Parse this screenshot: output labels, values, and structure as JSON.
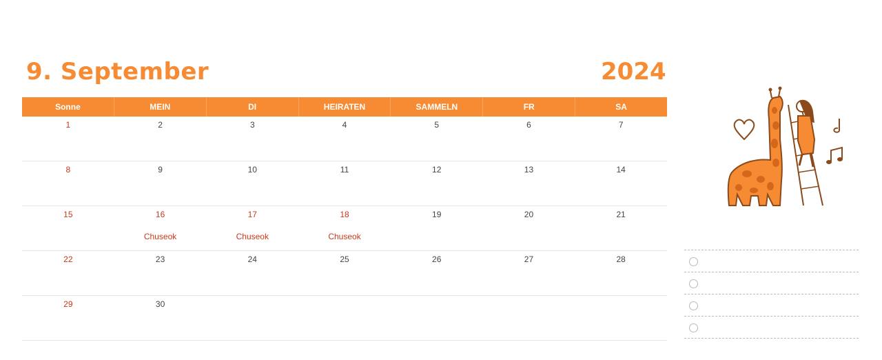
{
  "header": {
    "month": "9. September",
    "year": "2024"
  },
  "weekdays": [
    "Sonne",
    "MEIN",
    "DI",
    "HEIRATEN",
    "SAMMELN",
    "FR",
    "SA"
  ],
  "weeks": [
    [
      {
        "day": "1",
        "red": true,
        "event": ""
      },
      {
        "day": "2",
        "red": false,
        "event": ""
      },
      {
        "day": "3",
        "red": false,
        "event": ""
      },
      {
        "day": "4",
        "red": false,
        "event": ""
      },
      {
        "day": "5",
        "red": false,
        "event": ""
      },
      {
        "day": "6",
        "red": false,
        "event": ""
      },
      {
        "day": "7",
        "red": false,
        "event": ""
      }
    ],
    [
      {
        "day": "8",
        "red": true,
        "event": ""
      },
      {
        "day": "9",
        "red": false,
        "event": ""
      },
      {
        "day": "10",
        "red": false,
        "event": ""
      },
      {
        "day": "11",
        "red": false,
        "event": ""
      },
      {
        "day": "12",
        "red": false,
        "event": ""
      },
      {
        "day": "13",
        "red": false,
        "event": ""
      },
      {
        "day": "14",
        "red": false,
        "event": ""
      }
    ],
    [
      {
        "day": "15",
        "red": true,
        "event": ""
      },
      {
        "day": "16",
        "red": true,
        "event": "Chuseok"
      },
      {
        "day": "17",
        "red": true,
        "event": "Chuseok"
      },
      {
        "day": "18",
        "red": true,
        "event": "Chuseok"
      },
      {
        "day": "19",
        "red": false,
        "event": ""
      },
      {
        "day": "20",
        "red": false,
        "event": ""
      },
      {
        "day": "21",
        "red": false,
        "event": ""
      }
    ],
    [
      {
        "day": "22",
        "red": true,
        "event": ""
      },
      {
        "day": "23",
        "red": false,
        "event": ""
      },
      {
        "day": "24",
        "red": false,
        "event": ""
      },
      {
        "day": "25",
        "red": false,
        "event": ""
      },
      {
        "day": "26",
        "red": false,
        "event": ""
      },
      {
        "day": "27",
        "red": false,
        "event": ""
      },
      {
        "day": "28",
        "red": false,
        "event": ""
      }
    ],
    [
      {
        "day": "29",
        "red": true,
        "event": ""
      },
      {
        "day": "30",
        "red": false,
        "event": ""
      },
      {
        "day": "",
        "red": false,
        "event": ""
      },
      {
        "day": "",
        "red": false,
        "event": ""
      },
      {
        "day": "",
        "red": false,
        "event": ""
      },
      {
        "day": "",
        "red": false,
        "event": ""
      },
      {
        "day": "",
        "red": false,
        "event": ""
      }
    ]
  ],
  "todo_count": 4,
  "illustration": "giraffe-and-girl-on-ladder-illustration",
  "colors": {
    "accent": "#f68b33",
    "holiday": "#c8391a",
    "text": "#444444"
  }
}
